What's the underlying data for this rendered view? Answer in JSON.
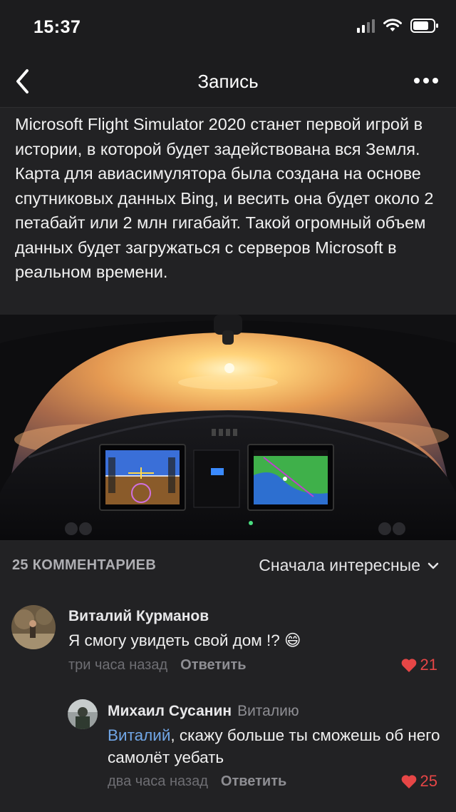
{
  "status_bar": {
    "time": "15:37"
  },
  "nav": {
    "title": "Запись"
  },
  "post": {
    "text": "Microsoft Flight Simulator 2020 станет первой игрой в истории, в которой будет задействована вся Земля. Карта для авиасимулятора была создана на основе спутниковых данных Bing, и весить она будет около 2 петабайт или 2 млн гигабайт. Такой огромный объем данных будет загружаться с серверов Microsoft в реальном времени."
  },
  "comments": {
    "count_label": "25 КОММЕНТАРИЕВ",
    "sort_label": "Сначала интересные",
    "items": [
      {
        "author": "Виталий Курманов",
        "text": "Я смогу увидеть свой дом !? 😄",
        "time": "три часа назад",
        "reply_label": "Ответить",
        "likes": "21"
      },
      {
        "author": "Михаил Сусанин",
        "reply_to": "Виталию",
        "mention": "Виталий",
        "text": ", скажу больше ты сможешь об него самолёт уебать",
        "time": "два часа назад",
        "reply_label": "Ответить",
        "likes": "25"
      }
    ]
  },
  "colors": {
    "accent_like": "#e64646",
    "mention": "#71a6e6",
    "background": "#222224"
  }
}
